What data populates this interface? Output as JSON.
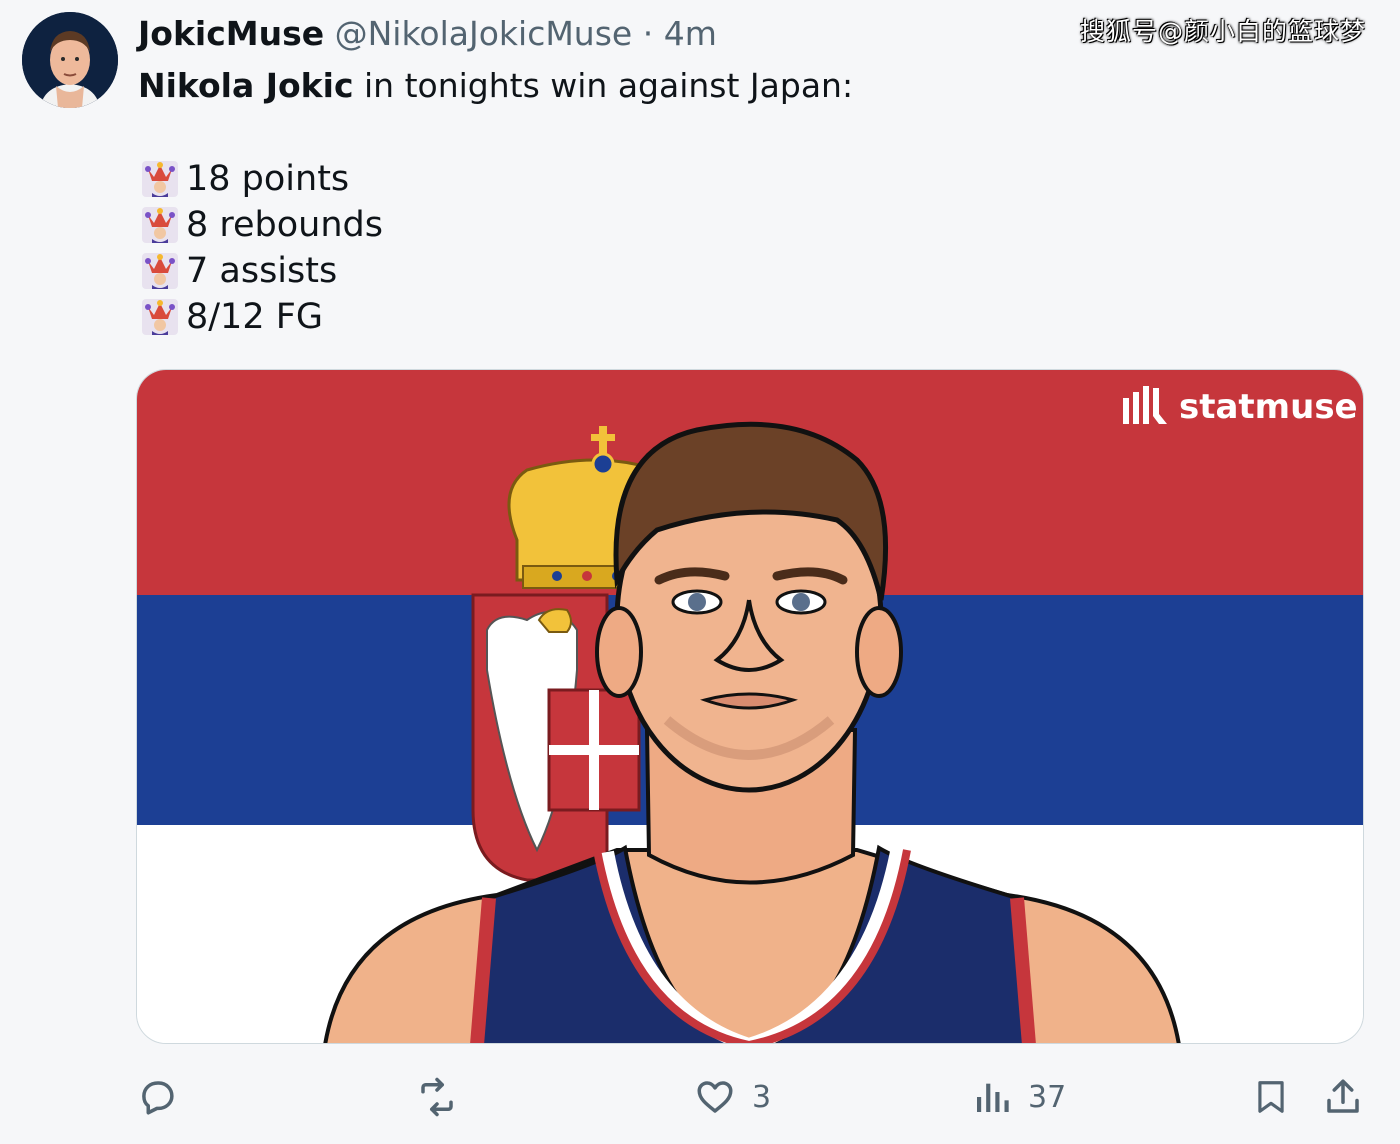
{
  "tweet": {
    "display_name": "JokicMuse",
    "handle": "@NikolaJokicMuse",
    "separator": "·",
    "time": "4m",
    "text_bold": "Nikola Jokic",
    "text_rest": " in tonights win against Japan:",
    "stats": [
      "18 points",
      "8 rebounds",
      "7 assists",
      "8/12 FG"
    ]
  },
  "watermark": "搜狐号@颜小白的篮球梦",
  "media": {
    "brand": "statmuse",
    "flag_colors": {
      "red": "#c6363c",
      "blue": "#1c3f94",
      "white": "#ffffff"
    }
  },
  "actions": {
    "reply_icon": "reply-icon",
    "retweet_icon": "retweet-icon",
    "like_icon": "heart-icon",
    "like_count": "3",
    "views_icon": "views-bar-chart-icon",
    "views_count": "37",
    "bookmark_icon": "bookmark-icon",
    "share_icon": "share-icon"
  }
}
